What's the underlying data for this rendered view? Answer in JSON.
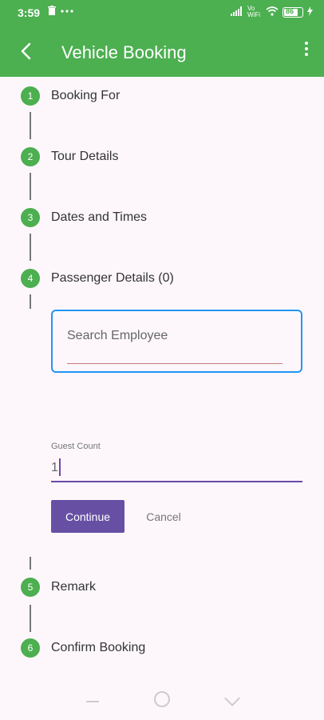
{
  "status_bar": {
    "time": "3:59",
    "network_label": "Vo WiFi",
    "battery_level": "86",
    "icons": [
      "trash-icon",
      "more-horizontal-icon",
      "signal-icon",
      "wifi-icon",
      "battery-icon",
      "charging-icon"
    ]
  },
  "app_bar": {
    "title": "Vehicle Booking",
    "background": "#4caf50"
  },
  "steps": [
    {
      "number": "1",
      "label": "Booking For"
    },
    {
      "number": "2",
      "label": "Tour Details"
    },
    {
      "number": "3",
      "label": "Dates and Times"
    },
    {
      "number": "4",
      "label": "Passenger Details (0)"
    },
    {
      "number": "5",
      "label": "Remark"
    },
    {
      "number": "6",
      "label": "Confirm Booking"
    }
  ],
  "passenger_form": {
    "search_placeholder": "Search Employee",
    "guest_count_label": "Guest Count",
    "guest_count_value": "1",
    "continue_label": "Continue",
    "cancel_label": "Cancel"
  },
  "colors": {
    "accent": "#4caf50",
    "primary_button": "#6750a4",
    "focus_border": "#2196f3"
  }
}
